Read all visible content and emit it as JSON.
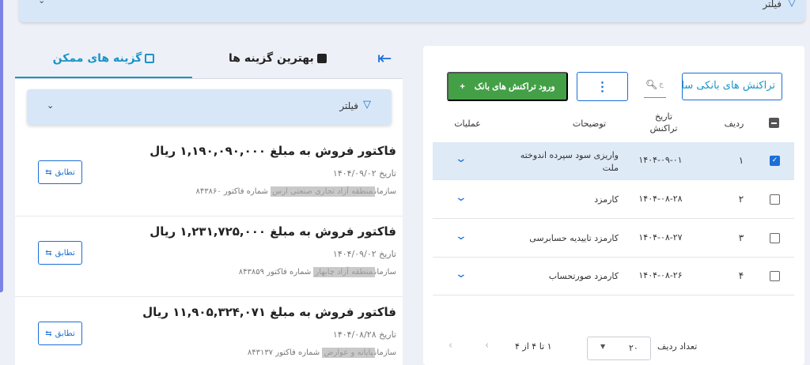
{
  "top_filter": {
    "label": "فیلتر"
  },
  "left_panel": {
    "tabs": {
      "best": "بهترین گزینه ها",
      "options": "گزینه های ممکن"
    },
    "filter_label": "فیلتر",
    "invoices": [
      {
        "title": "فاکتور فروش به مبلغ ۱,۱۹۰,۰۹۰,۰۰۰ ریال",
        "date": "تاریخ ۱۴۰۴/۰۹/۰۲",
        "org_prefix": "سازمان",
        "org": "منطقه آزاد تجاری صنعتی ارس",
        "invoice_no": "شماره فاکتور ۸۴۳۸۶۰",
        "match_label": "تطابق"
      },
      {
        "title": "فاکتور فروش به مبلغ ۱,۲۳۱,۷۲۵,۰۰۰ ریال",
        "date": "تاریخ ۱۴۰۴/۰۹/۰۲",
        "org_prefix": "سازمان",
        "org": "منطقه آزاد چابهار",
        "invoice_no": "شماره فاکتور ۸۴۳۸۵۹",
        "match_label": "تطابق"
      },
      {
        "title": "فاکتور فروش به مبلغ ۱۱,۹۰۵,۳۲۴,۰۷۱ ریال",
        "date": "تاریخ ۱۴۰۴/۰۸/۲۸",
        "org_prefix": "سازمان",
        "org": "پایانه و عوارض",
        "invoice_no": "شماره فاکتور ۸۴۳۱۳۷",
        "match_label": "تطابق"
      }
    ]
  },
  "right_panel": {
    "select_value": "تراکنش های بانکی سال",
    "search_placeholder": "ج",
    "more_label": "⋮",
    "import_label": "ورود تراکنش های بانک",
    "import_icon": "+",
    "headers": {
      "row": "ردیف",
      "date_line1": "تاریخ",
      "date_line2": "تراکنش",
      "desc": "توضیحات",
      "ops": "عملیات"
    },
    "rows": [
      {
        "num": "۱",
        "date": "۱۴۰۴-۰۹-۰۱",
        "desc": "واریزی سود سپرده اندوخته ملت",
        "selected": true
      },
      {
        "num": "۲",
        "date": "۱۴۰۴-۰۸-۲۸",
        "desc": "کارمزد",
        "selected": false
      },
      {
        "num": "۳",
        "date": "۱۴۰۴-۰۸-۲۷",
        "desc": "کارمزد تاییدیه حسابرسی",
        "selected": false
      },
      {
        "num": "۴",
        "date": "۱۴۰۴-۰۸-۲۶",
        "desc": "کارمزد صورتحساب",
        "selected": false
      }
    ],
    "pager": {
      "rows_label": "تعداد ردیف",
      "page_size": "۲۰",
      "range": "۱ تا ۴ از ۴"
    }
  },
  "colors": {
    "accent": "#1b6fd6",
    "tab_active": "#1995c9",
    "success": "#43a047",
    "filter_bg": "#d7e7f7"
  }
}
